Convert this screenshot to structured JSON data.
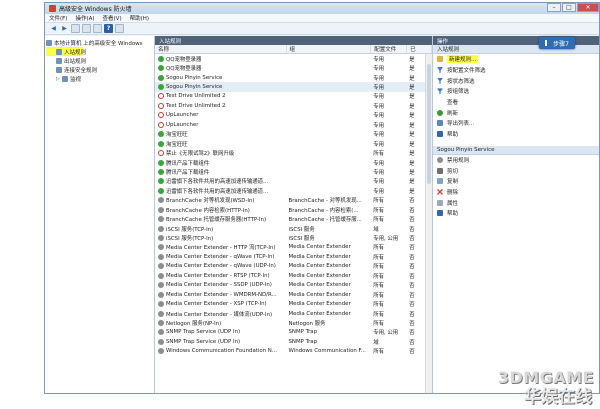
{
  "window": {
    "title": "高级安全 Windows 防火墙"
  },
  "menu": [
    "文件(F)",
    "操作(A)",
    "查看(V)",
    "帮助(H)"
  ],
  "tree": {
    "root": "本地计算机 上的高级安全 Windows",
    "items": [
      "入站规则",
      "出站规则",
      "连接安全规则",
      "监视"
    ]
  },
  "main": {
    "header": "入站规则",
    "columns": {
      "name": "名称",
      "group": "组",
      "profile": "配置文件",
      "enabled": "已"
    },
    "rows": [
      {
        "status": "allow",
        "name": "QQ宠物登录器",
        "group": "",
        "profile": "专用",
        "enabled": "是"
      },
      {
        "status": "allow",
        "name": "QQ宠物登录器",
        "group": "",
        "profile": "专用",
        "enabled": "是"
      },
      {
        "status": "allow",
        "name": "Sogou Pinyin Service",
        "group": "",
        "profile": "专用",
        "enabled": "是"
      },
      {
        "status": "allow",
        "name": "Sogou Pinyin Service",
        "group": "",
        "profile": "专用",
        "enabled": "是"
      },
      {
        "status": "block",
        "name": "Test Drive Unlimited 2",
        "group": "",
        "profile": "专用",
        "enabled": "是"
      },
      {
        "status": "block",
        "name": "Test Drive Unlimited 2",
        "group": "",
        "profile": "专用",
        "enabled": "是"
      },
      {
        "status": "block",
        "name": "UpLauncher",
        "group": "",
        "profile": "专用",
        "enabled": "是"
      },
      {
        "status": "block",
        "name": "UpLauncher",
        "group": "",
        "profile": "专用",
        "enabled": "是"
      },
      {
        "status": "allow",
        "name": "淘宝旺旺",
        "group": "",
        "profile": "专用",
        "enabled": "是"
      },
      {
        "status": "allow",
        "name": "淘宝旺旺",
        "group": "",
        "profile": "专用",
        "enabled": "是"
      },
      {
        "status": "block",
        "name": "禁止《无限试驾2》联网升级",
        "group": "",
        "profile": "所有",
        "enabled": "是"
      },
      {
        "status": "allow",
        "name": "腾讯产品下载组件",
        "group": "",
        "profile": "专用",
        "enabled": "是"
      },
      {
        "status": "allow",
        "name": "腾讯产品下载组件",
        "group": "",
        "profile": "专用",
        "enabled": "是"
      },
      {
        "status": "allow",
        "name": "迅雷旗下各软件共用的高速加速传输通道...",
        "group": "",
        "profile": "专用",
        "enabled": "是"
      },
      {
        "status": "allow",
        "name": "迅雷旗下各软件共用的高速加速传输通道...",
        "group": "",
        "profile": "专用",
        "enabled": "是"
      },
      {
        "status": "off",
        "name": "BranchCache 对等机发现(WSD-In)",
        "group": "BranchCache - 对等机发现...",
        "profile": "所有",
        "enabled": "否"
      },
      {
        "status": "off",
        "name": "BranchCache 内容检索(HTTP-In)",
        "group": "BranchCache - 内容检索(...",
        "profile": "所有",
        "enabled": "否"
      },
      {
        "status": "off",
        "name": "BranchCache 托管缓存服务器(HTTP-In)",
        "group": "BranchCache - 托管缓存服...",
        "profile": "所有",
        "enabled": "否"
      },
      {
        "status": "off",
        "name": "iSCSI 服务(TCP-In)",
        "group": "iSCSI 服务",
        "profile": "域",
        "enabled": "否"
      },
      {
        "status": "off",
        "name": "iSCSI 服务(TCP-In)",
        "group": "iSCSI 服务",
        "profile": "专用, 公用",
        "enabled": "否"
      },
      {
        "status": "off",
        "name": "Media Center Extender - HTTP 流(TCP-In)",
        "group": "Media Center Extender",
        "profile": "所有",
        "enabled": "否"
      },
      {
        "status": "off",
        "name": "Media Center Extender - qWave (TCP-In)",
        "group": "Media Center Extender",
        "profile": "所有",
        "enabled": "否"
      },
      {
        "status": "off",
        "name": "Media Center Extender - qWave (UDP-In)",
        "group": "Media Center Extender",
        "profile": "所有",
        "enabled": "否"
      },
      {
        "status": "off",
        "name": "Media Center Extender - RTSP (TCP-In)",
        "group": "Media Center Extender",
        "profile": "所有",
        "enabled": "否"
      },
      {
        "status": "off",
        "name": "Media Center Extender - SSDP (UDP-In)",
        "group": "Media Center Extender",
        "profile": "所有",
        "enabled": "否"
      },
      {
        "status": "off",
        "name": "Media Center Extender - WMDRM-ND/R...",
        "group": "Media Center Extender",
        "profile": "所有",
        "enabled": "否"
      },
      {
        "status": "off",
        "name": "Media Center Extender - XSP (TCP-In)",
        "group": "Media Center Extender",
        "profile": "所有",
        "enabled": "否"
      },
      {
        "status": "off",
        "name": "Media Center Extender - 媒体流(UDP-In)",
        "group": "Media Center Extender",
        "profile": "所有",
        "enabled": "否"
      },
      {
        "status": "off",
        "name": "Netlogon 服务(NP-In)",
        "group": "Netlogon 服务",
        "profile": "所有",
        "enabled": "否"
      },
      {
        "status": "off",
        "name": "SNMP Trap Service (UDP In)",
        "group": "SNMP Trap",
        "profile": "专用, 公用",
        "enabled": "否"
      },
      {
        "status": "off",
        "name": "SNMP Trap Service (UDP In)",
        "group": "SNMP Trap",
        "profile": "域",
        "enabled": "否"
      },
      {
        "status": "off",
        "name": "Windows Communication Foundation N...",
        "group": "Windows Communication F...",
        "profile": "所有",
        "enabled": "否"
      }
    ]
  },
  "actions": {
    "header": "操作",
    "section1": "入站规则",
    "items1": [
      {
        "icon": "new",
        "label": "新建规则..."
      },
      {
        "icon": "filter",
        "label": "按配置文件筛选"
      },
      {
        "icon": "filter",
        "label": "按状态筛选"
      },
      {
        "icon": "filter",
        "label": "按组筛选"
      },
      {
        "icon": "blank",
        "label": "查看"
      },
      {
        "icon": "refresh",
        "label": "刷新"
      },
      {
        "icon": "export",
        "label": "导出列表..."
      },
      {
        "icon": "help",
        "label": "帮助"
      }
    ],
    "section2": "Sogou Pinyin Service",
    "items2": [
      {
        "icon": "off",
        "label": "禁用规则"
      },
      {
        "icon": "cut",
        "label": "剪切"
      },
      {
        "icon": "copy",
        "label": "复制"
      },
      {
        "icon": "del",
        "label": "删除"
      },
      {
        "icon": "prop",
        "label": "属性"
      },
      {
        "icon": "help",
        "label": "帮助"
      }
    ]
  },
  "badge": "步骤7",
  "watermark": {
    "line1": "3DMGAME",
    "line2": "华娱在线"
  }
}
